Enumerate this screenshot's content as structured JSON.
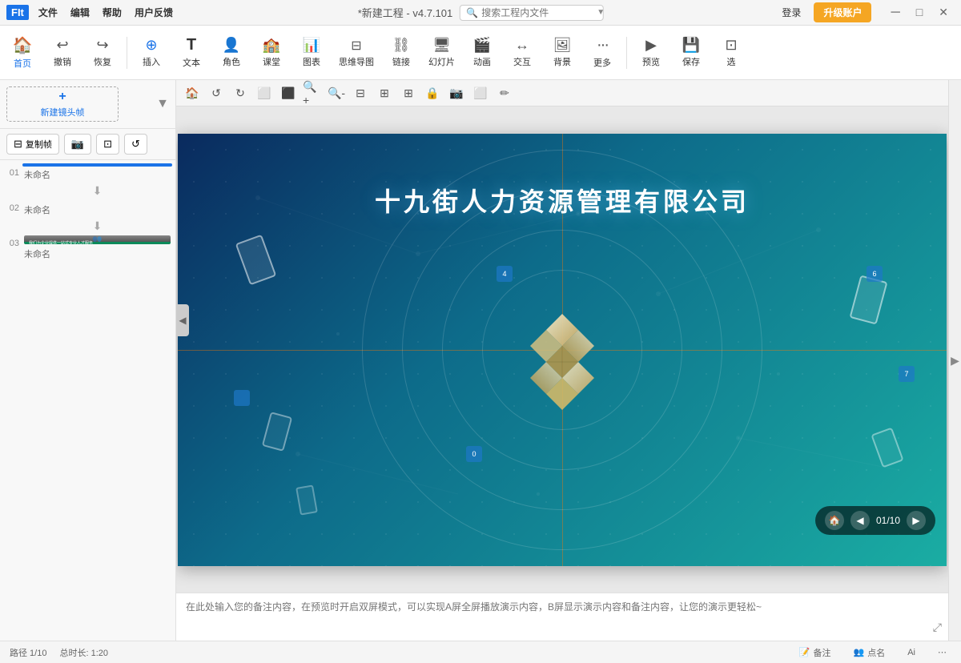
{
  "titlebar": {
    "logo": "FIt",
    "menu": [
      "文件",
      "编辑",
      "帮助",
      "用户反馈"
    ],
    "title": "*新建工程 - v4.7.101",
    "search_placeholder": "搜索工程内文件",
    "login_label": "登录",
    "upgrade_label": "升级账户"
  },
  "toolbar": {
    "items": [
      {
        "id": "home",
        "icon": "🏠",
        "label": "首页"
      },
      {
        "id": "undo",
        "icon": "↩",
        "label": "撤销"
      },
      {
        "id": "redo",
        "icon": "↪",
        "label": "恢复"
      },
      {
        "id": "insert",
        "icon": "⊕",
        "label": "插入"
      },
      {
        "id": "text",
        "icon": "T",
        "label": "文本"
      },
      {
        "id": "role",
        "icon": "👤",
        "label": "角色"
      },
      {
        "id": "classroom",
        "icon": "🏫",
        "label": "课堂"
      },
      {
        "id": "chart",
        "icon": "📊",
        "label": "图表"
      },
      {
        "id": "mindmap",
        "icon": "🔗",
        "label": "思维导图"
      },
      {
        "id": "link",
        "icon": "🔗",
        "label": "链接"
      },
      {
        "id": "slideshow",
        "icon": "🖥",
        "label": "幻灯片"
      },
      {
        "id": "animation",
        "icon": "▶",
        "label": "动画"
      },
      {
        "id": "interact",
        "icon": "↔",
        "label": "交互"
      },
      {
        "id": "bg",
        "icon": "🖼",
        "label": "背景"
      },
      {
        "id": "more",
        "icon": "⋯",
        "label": "更多"
      },
      {
        "id": "preview",
        "icon": "▷",
        "label": "预览"
      },
      {
        "id": "save",
        "icon": "💾",
        "label": "保存"
      },
      {
        "id": "select",
        "icon": "⊡",
        "label": "选"
      }
    ]
  },
  "sidebar": {
    "new_frame_label": "新建镜头帧",
    "copy_btn": "复制帧",
    "tools": [
      "📷",
      "⊡",
      "↺"
    ],
    "slides": [
      {
        "num": "01",
        "label": "未命名",
        "active": true
      },
      {
        "num": "02",
        "label": "未命名",
        "active": false
      },
      {
        "num": "03",
        "label": "未命名",
        "active": false
      }
    ]
  },
  "canvas": {
    "slide_title": "十九街人力资源管理有限公司",
    "tools": [
      "🏠",
      "↺",
      "↻",
      "⬜",
      "⬜",
      "🔍",
      "🔍",
      "⊟",
      "⊞",
      "⊡",
      "🔒",
      "📷",
      "⬜",
      "✏"
    ]
  },
  "notes": {
    "placeholder": "在此处输入您的备注内容，在预览时开启双屏模式，可以实现A屏全屏播放演示内容，B屏显示演示内容和备注内容，让您的演示更轻松~"
  },
  "statusbar": {
    "path": "路径 1/10",
    "duration": "总时长: 1:20",
    "notes_btn": "备注",
    "roll_call_btn": "点名",
    "ai_btn": "Ai",
    "slide_nav": "01/10"
  }
}
